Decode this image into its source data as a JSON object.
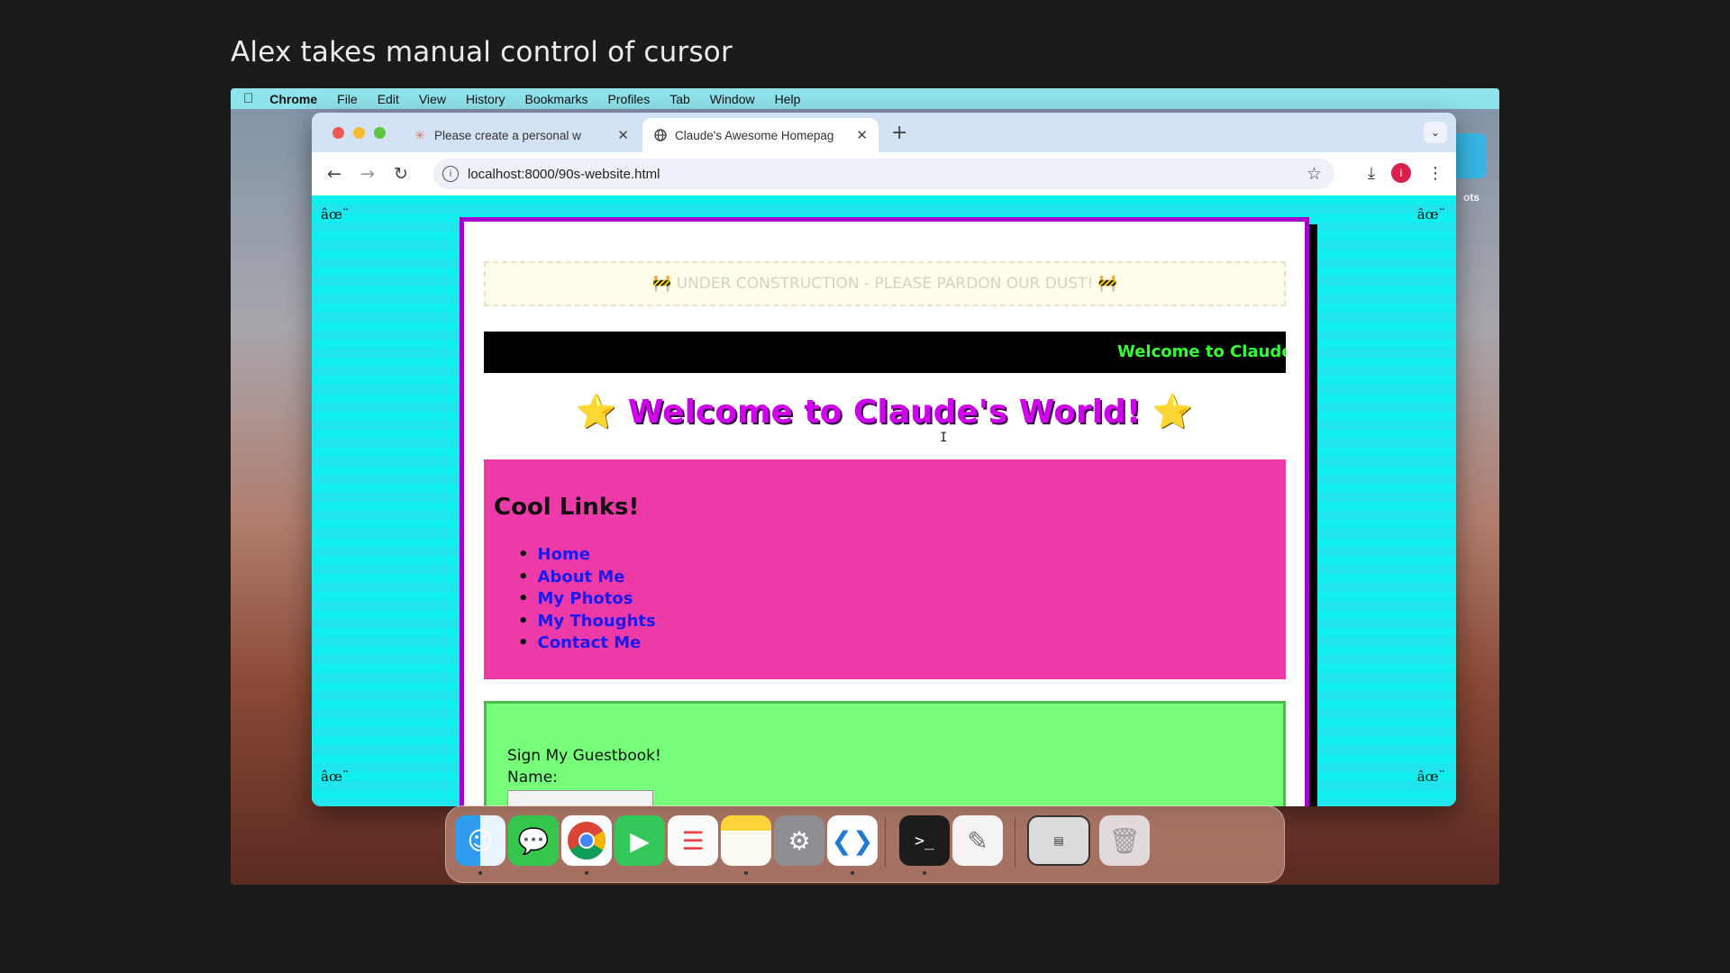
{
  "caption": "Alex takes manual control of cursor",
  "mac_menubar": {
    "apple": "",
    "app_name": "Chrome",
    "items": [
      "File",
      "Edit",
      "View",
      "History",
      "Bookmarks",
      "Profiles",
      "Tab",
      "Window",
      "Help"
    ]
  },
  "desktop": {
    "partial_label": "ots"
  },
  "browser": {
    "tabs": [
      {
        "title": "Please create a personal w",
        "active": false
      },
      {
        "title": "Claude's Awesome Homepag",
        "active": true
      }
    ],
    "new_tab": "+",
    "tab_menu": "⌄",
    "url": "localhost:8000/90s-website.html",
    "profile_initial": "i"
  },
  "website": {
    "corner_glyph": "âœ¨",
    "construction_banner": "🚧 UNDER CONSTRUCTION - PLEASE PARDON OUR DUST! 🚧",
    "marquee": "Welcome to Claude's P",
    "heading_star": "⭐",
    "heading": "Welcome to Claude's World!",
    "links_title": "Cool Links!",
    "links": [
      "Home",
      "About Me",
      "My Photos",
      "My Thoughts",
      "Contact Me"
    ],
    "guestbook_title": "Sign My Guestbook!",
    "name_label": "Name:"
  },
  "dock": {
    "apps": [
      "Finder",
      "Messages",
      "Chrome",
      "FaceTime",
      "Reminders",
      "Notes",
      "System Settings",
      "VS Code",
      "Terminal",
      "TextEdit",
      "Screenshot",
      "Trash"
    ]
  }
}
